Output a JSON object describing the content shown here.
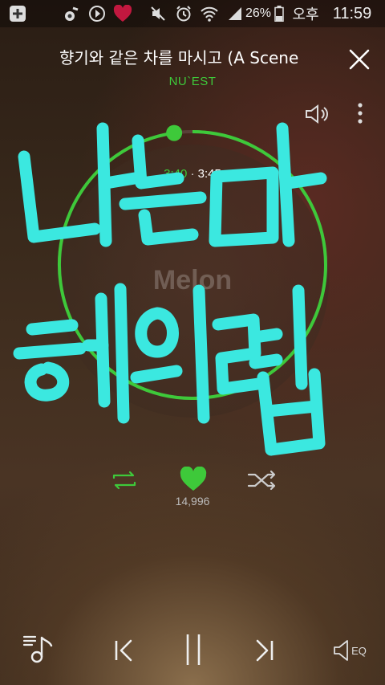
{
  "status_bar": {
    "icons": [
      "plus-box-icon",
      "music-note-icon",
      "play-circle-icon",
      "heart-icon",
      "mute-icon",
      "alarm-icon",
      "wifi-icon",
      "signal-icon",
      "battery-icon"
    ],
    "battery": "26%",
    "ampm": "오후",
    "time": "11:59"
  },
  "now_playing": {
    "title": "향기와 같은 차를 마시고 (A Scene",
    "artist": "NU`EST",
    "elapsed": "3:40",
    "separator": "·",
    "duration": "3:45",
    "progress": 0.978,
    "logo": "Melon",
    "like_count": "14,996"
  },
  "handwriting": {
    "line1": "나는 마",
    "line2": "해의렵",
    "color": "#3be8e0"
  },
  "colors": {
    "accent": "#3ec93a"
  },
  "bottom_bar": {
    "eq_label": "EQ"
  }
}
